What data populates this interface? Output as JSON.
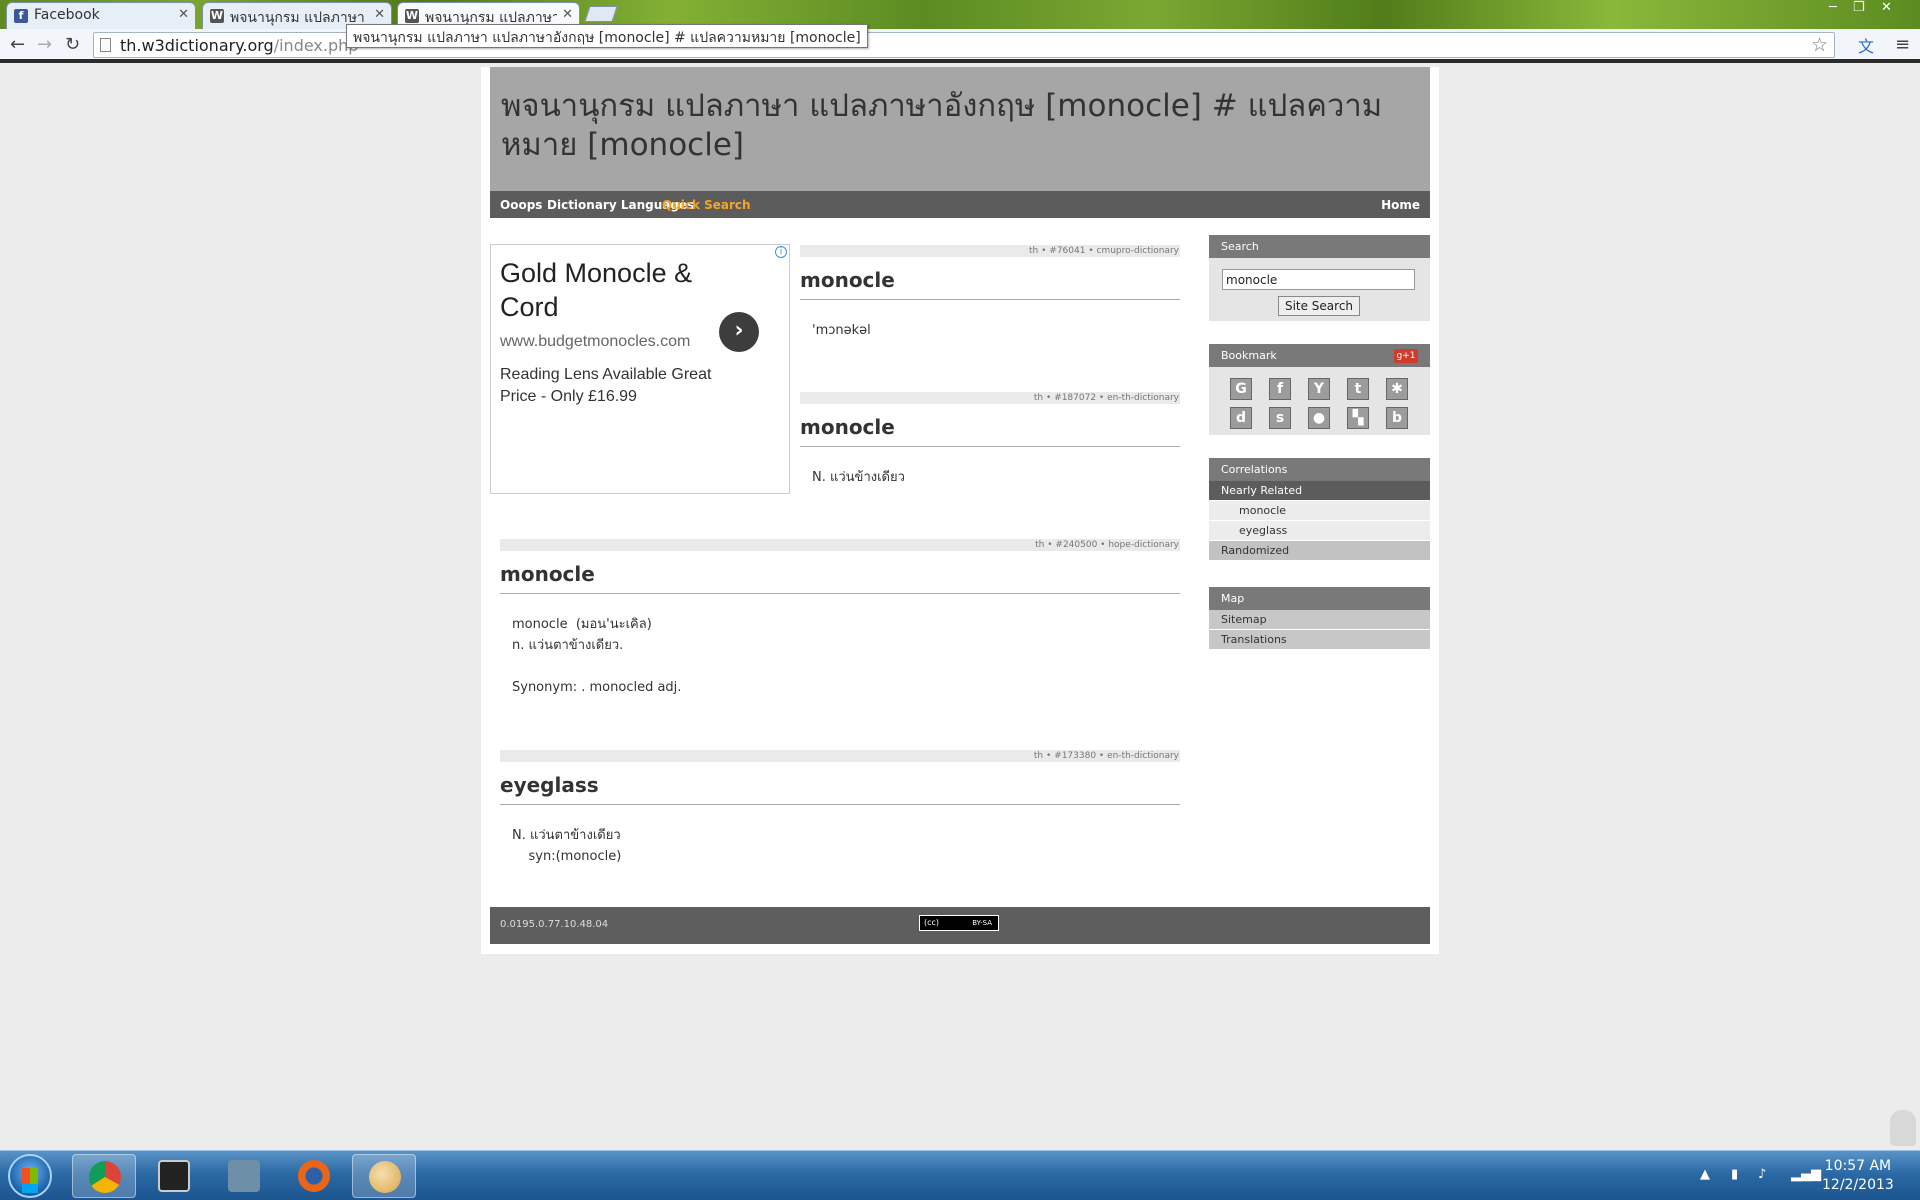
{
  "browser": {
    "tabs": [
      {
        "title": "Facebook",
        "favicon": "facebook-icon",
        "active": false
      },
      {
        "title": "พจนานุกรม แปลภาษา แ",
        "favicon": "w3-icon",
        "active": false
      },
      {
        "title": "พจนานุกรม แปลภาษา แ",
        "favicon": "w3-icon",
        "active": true
      }
    ],
    "url_host": "th.w3dictionary.org",
    "url_path": "/index.php",
    "tooltip": "พจนานุกรม แปลภาษา แปลภาษาอังกฤษ [monocle] # แปลความหมาย [monocle]"
  },
  "page": {
    "title": "พจนานุกรม แปลภาษา แปลภาษาอังกฤษ [monocle] # แปลความหมาย [monocle]",
    "menu": [
      "Ooops",
      "Dictionary Languages",
      "Quick Search",
      "Home"
    ],
    "accent_color": "#f5a623"
  },
  "ad": {
    "headline": "Gold Monocle & Cord",
    "url": "www.budgetmonocles.com",
    "description": "Reading Lens Available Great Price - Only £16.99"
  },
  "entries": [
    {
      "meta": "th • #76041 • cmupro-dictionary",
      "word": "monocle",
      "text": "'mɔnəkəl"
    },
    {
      "meta": "th • #187072 • en-th-dictionary",
      "word": "monocle",
      "text": "N. แว่นข้างเดียว"
    },
    {
      "meta": "th • #240500 • hope-dictionary",
      "word": "monocle",
      "text": "monocle  (มอน'นะเคิล)\nn. แว่นตาข้างเดียว.\n\nSynonym: . monocled adj."
    },
    {
      "meta": "th • #173380 • en-th-dictionary",
      "word": "eyeglass",
      "text": "N. แว่นตาข้างเดียว\n    syn:(monocle)"
    }
  ],
  "sidebar": {
    "search_title": "Search",
    "search_value": "monocle",
    "search_button": "Site Search",
    "bookmark_title": "Bookmark",
    "gplus": "g+1",
    "bookmarks": [
      "google-icon",
      "facebook-icon",
      "yahoo-icon",
      "technorati-icon",
      "myspace-icon",
      "digg-icon",
      "stumbleupon-icon",
      "reddit-icon",
      "delicious-icon",
      "blogger-icon"
    ],
    "correlations_title": "Correlations",
    "nearly_related": "Nearly Related",
    "related": [
      "monocle",
      "eyeglass"
    ],
    "randomized": "Randomized",
    "map_title": "Map",
    "map_links": [
      "Sitemap",
      "Translations"
    ]
  },
  "footer": {
    "text": "0.0195.0.77.10.48.04",
    "license": "BY-SA"
  },
  "taskbar": {
    "time": "10:57 AM",
    "date": "12/2/2013"
  }
}
